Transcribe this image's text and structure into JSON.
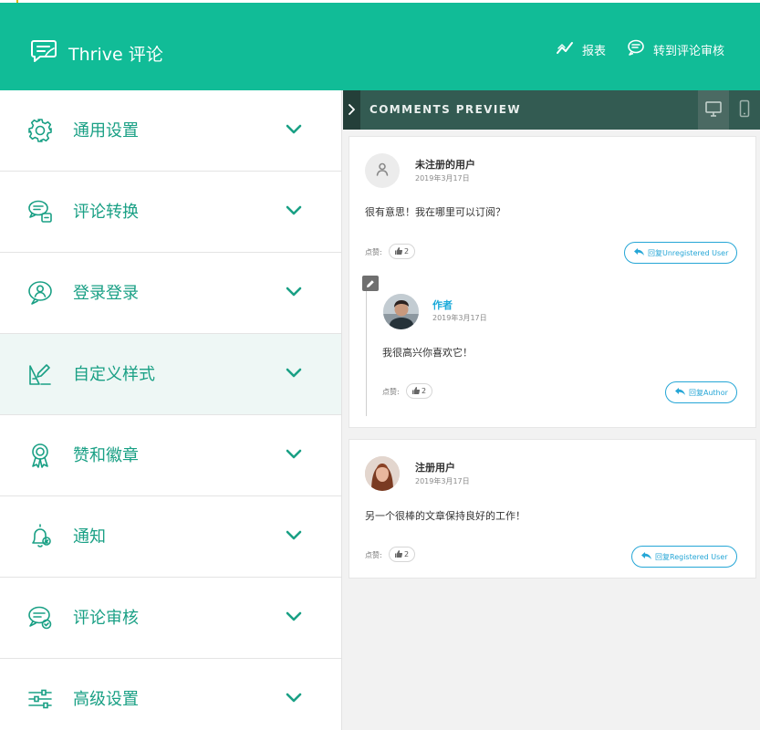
{
  "header": {
    "title": "Thrive 评论",
    "report_label": "报表",
    "moderation_label": "转到评论审核"
  },
  "sidebar": {
    "items": [
      {
        "label": "通用设置",
        "icon": "gear-icon"
      },
      {
        "label": "评论转换",
        "icon": "comment-convert-icon"
      },
      {
        "label": "登录登录",
        "icon": "user-login-icon"
      },
      {
        "label": "自定义样式",
        "icon": "style-icon"
      },
      {
        "label": "赞和徽章",
        "icon": "badge-icon"
      },
      {
        "label": "通知",
        "icon": "bell-icon"
      },
      {
        "label": "评论审核",
        "icon": "moderation-icon"
      },
      {
        "label": "高级设置",
        "icon": "sliders-icon"
      }
    ],
    "active_index": 3
  },
  "preview": {
    "title": "COMMENTS PREVIEW",
    "comments": [
      {
        "name": "未注册的用户",
        "date": "2019年3月17日",
        "text": "很有意思！我在哪里可以订阅？",
        "likes_label": "点赞:",
        "likes": "2",
        "reply_label": "回复Unregistered User"
      },
      {
        "name": "作者",
        "date": "2019年3月17日",
        "text": "我很高兴你喜欢它！",
        "likes_label": "点赞:",
        "likes": "2",
        "reply_label": "回复Author"
      },
      {
        "name": "注册用户",
        "date": "2019年3月17日",
        "text": "另一个很棒的文章保持良好的工作！",
        "likes_label": "点赞:",
        "likes": "2",
        "reply_label": "回复Registered User"
      }
    ]
  },
  "colors": {
    "brand": "#11bc97",
    "accent_text": "#1aa085",
    "preview_bar": "#335b52",
    "link_blue": "#25a6d6"
  }
}
